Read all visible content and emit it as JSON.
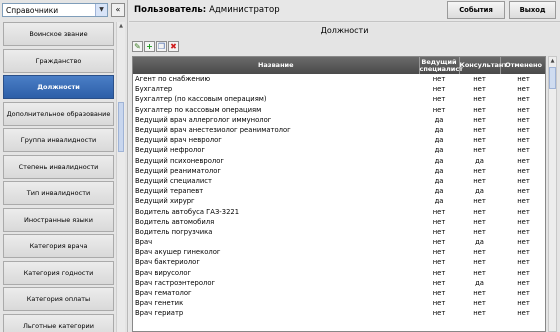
{
  "sidebar": {
    "dropdown_value": "Справочники",
    "collapse_label": "«",
    "items": [
      {
        "label": "Воинское звание"
      },
      {
        "label": "Гражданство"
      },
      {
        "label": "Должности",
        "active": true
      },
      {
        "label": "Дополнительное образование"
      },
      {
        "label": "Группа инвалидности"
      },
      {
        "label": "Степень инвалидности"
      },
      {
        "label": "Тип инвалидности"
      },
      {
        "label": "Иностранные языки"
      },
      {
        "label": "Категория врача"
      },
      {
        "label": "Категория годности"
      },
      {
        "label": "Категория оплаты"
      },
      {
        "label": "Льготные категории"
      }
    ]
  },
  "header": {
    "user_prefix": "Пользователь:",
    "user_name": "Администратор",
    "events_label": "События",
    "exit_label": "Выход"
  },
  "main": {
    "title": "Должности",
    "toolbar": {
      "edit_icon": "edit-icon",
      "add_icon": "add-icon",
      "copy_icon": "copy-icon",
      "delete_icon": "delete-icon"
    },
    "table": {
      "columns": [
        "Название",
        "Ведущий специалист",
        "Консультант",
        "Отменено"
      ],
      "rows": [
        [
          "Агент по снабжению",
          "нет",
          "нет",
          "нет"
        ],
        [
          "Бухгалтер",
          "нет",
          "нет",
          "нет"
        ],
        [
          "Бухгалтер (по кассовым операциям)",
          "нет",
          "нет",
          "нет"
        ],
        [
          "Бухгалтер по кассовым операциям",
          "нет",
          "нет",
          "нет"
        ],
        [
          "Ведущий врач аллерголог иммунолог",
          "да",
          "нет",
          "нет"
        ],
        [
          "Ведущий врач анестезиолог реаниматолог",
          "да",
          "нет",
          "нет"
        ],
        [
          "Ведущий врач невролог",
          "да",
          "нет",
          "нет"
        ],
        [
          "Ведущий нефролог",
          "да",
          "нет",
          "нет"
        ],
        [
          "Ведущий психоневролог",
          "да",
          "да",
          "нет"
        ],
        [
          "Ведущий реаниматолог",
          "да",
          "нет",
          "нет"
        ],
        [
          "Ведущий специалист",
          "да",
          "нет",
          "нет"
        ],
        [
          "Ведущий терапевт",
          "да",
          "да",
          "нет"
        ],
        [
          "Ведущий хирург",
          "да",
          "нет",
          "нет"
        ],
        [
          "Водитель автобуса ГАЗ-3221",
          "нет",
          "нет",
          "нет"
        ],
        [
          "Водитель автомобиля",
          "нет",
          "нет",
          "нет"
        ],
        [
          "Водитель погрузчика",
          "нет",
          "нет",
          "нет"
        ],
        [
          "Врач",
          "нет",
          "да",
          "нет"
        ],
        [
          "Врач акушер гинеколог",
          "нет",
          "нет",
          "нет"
        ],
        [
          "Врач бактериолог",
          "нет",
          "нет",
          "нет"
        ],
        [
          "Врач вирусолог",
          "нет",
          "нет",
          "нет"
        ],
        [
          "Врач гастроэнтеролог",
          "нет",
          "да",
          "нет"
        ],
        [
          "Врач гематолог",
          "нет",
          "нет",
          "нет"
        ],
        [
          "Врач генетик",
          "нет",
          "нет",
          "нет"
        ],
        [
          "Врач гериатр",
          "нет",
          "нет",
          "нет"
        ]
      ]
    }
  }
}
